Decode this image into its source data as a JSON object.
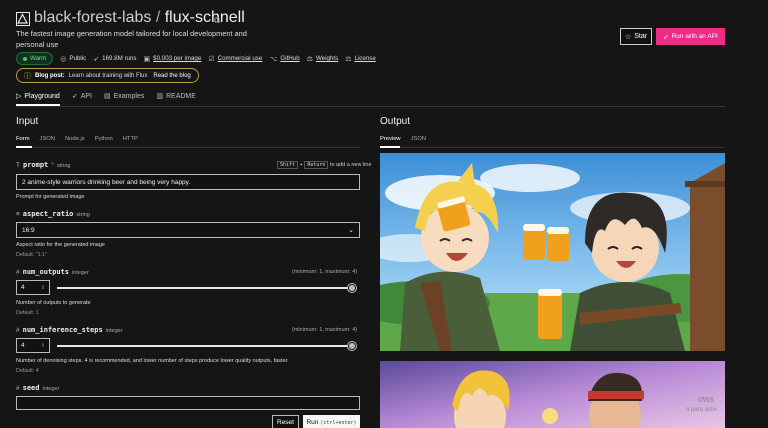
{
  "header": {
    "owner": "black-forest-labs",
    "separator": "/",
    "model": "flux-schnell",
    "description": "The fastest image generation model tailored for local development and personal use",
    "star_label": "Star",
    "api_label": "Run with an API"
  },
  "meta": {
    "status": "Warm",
    "visibility": "Public",
    "runs": "169.8M runs",
    "price": "$0.003 per image",
    "commercial": "Commercial use",
    "github": "GitHub",
    "weights": "Weights",
    "license": "License"
  },
  "blog": {
    "prefix": "Blog post:",
    "text": "Learn about training with Flux",
    "link": "Read the blog"
  },
  "main_tabs": [
    "Playground",
    "API",
    "Examples",
    "README"
  ],
  "input": {
    "heading": "Input",
    "tabs": [
      "Form",
      "JSON",
      "Node.js",
      "Python",
      "HTTP"
    ],
    "prompt": {
      "name": "prompt",
      "required_mark": "*",
      "type": "string",
      "hint_keys": [
        "Shift",
        "+",
        "Return"
      ],
      "hint_text": "to add a new line",
      "value": "2 anime-style warriors drinking beer and being very happy.",
      "note": "Prompt for generated image"
    },
    "aspect_ratio": {
      "name": "aspect_ratio",
      "type": "string",
      "value": "16:9",
      "note": "Aspect ratio for the generated image",
      "default": "Default: \"1:1\""
    },
    "num_outputs": {
      "name": "num_outputs",
      "type": "integer",
      "range": "(minimum: 1, maximum: 4)",
      "value": "4",
      "slider_fraction": 1.0,
      "note": "Number of outputs to generate",
      "default": "Default: 1"
    },
    "num_inference_steps": {
      "name": "num_inference_steps",
      "type": "integer",
      "range": "(minimum: 1, maximum: 4)",
      "value": "4",
      "slider_fraction": 1.0,
      "note": "Number of denoising steps. 4 is recommended, and lower number of steps produce lower quality outputs, faster.",
      "default": "Default: 4"
    },
    "seed": {
      "name": "seed",
      "type": "integer",
      "value": ""
    },
    "reset_label": "Reset",
    "run_label": "Run",
    "run_shortcut": "(ctrl+enter)"
  },
  "output": {
    "heading": "Output",
    "tabs": [
      "Preview",
      "JSON"
    ]
  },
  "watermark": {
    "line1": "ows",
    "line2": "n para activ"
  },
  "colors": {
    "accent_pink": "#ea2e85",
    "warm_green": "#34d058",
    "blog_border": "#b8a23c"
  }
}
